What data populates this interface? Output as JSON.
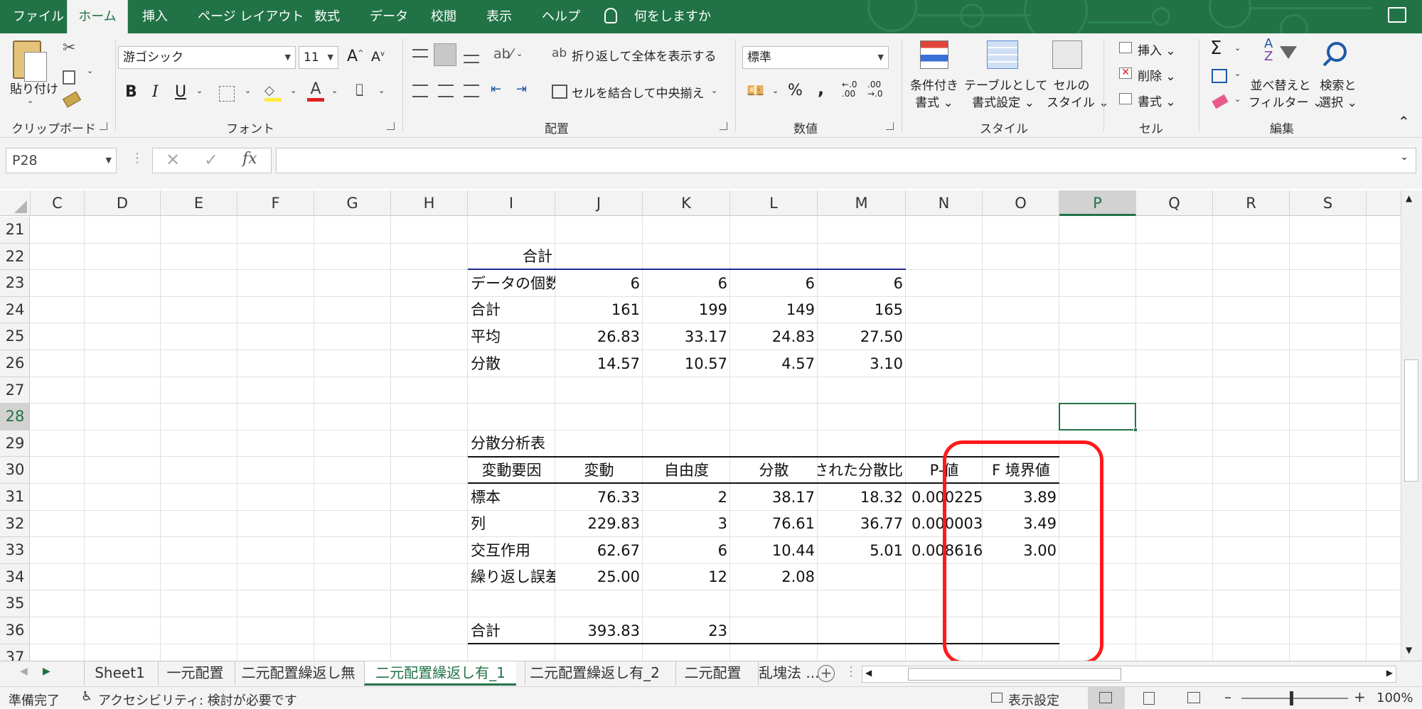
{
  "ribbon_tabs": [
    "ファイル",
    "ホーム",
    "挿入",
    "ページ レイアウト",
    "数式",
    "データ",
    "校閲",
    "表示",
    "ヘルプ"
  ],
  "tell_me": "何をしますか",
  "ribbon": {
    "clipboard": {
      "paste": "貼り付け",
      "label": "クリップボード"
    },
    "font": {
      "name": "游ゴシック",
      "size": "11",
      "label": "フォント",
      "bold": "B",
      "italic": "I",
      "underline": "U"
    },
    "alignment": {
      "wrap": "折り返して全体を表示する",
      "merge": "セルを結合して中央揃え",
      "label": "配置"
    },
    "number": {
      "format": "標準",
      "percent": "%",
      "comma": ",",
      "label": "数値"
    },
    "styles": {
      "conditional": "条件付き\n書式",
      "table": "テーブルとして\n書式設定",
      "cell": "セルの\nスタイル",
      "label": "スタイル",
      "conditional_l1": "条件付き",
      "conditional_l2": "書式",
      "table_l1": "テーブルとして",
      "table_l2": "書式設定",
      "cell_l1": "セルの",
      "cell_l2": "スタイル"
    },
    "cells": {
      "insert": "挿入",
      "delete": "削除",
      "format": "書式",
      "label": "セル"
    },
    "editing": {
      "sum": "Σ",
      "sort_l1": "並べ替えと",
      "sort_l2": "フィルター",
      "find_l1": "検索と",
      "find_l2": "選択",
      "label": "編集"
    }
  },
  "name_box": "P28",
  "fx": "fx",
  "columns": [
    "C",
    "D",
    "E",
    "F",
    "G",
    "H",
    "I",
    "J",
    "K",
    "L",
    "M",
    "N",
    "O",
    "P",
    "Q",
    "R",
    "S"
  ],
  "rows": [
    "21",
    "22",
    "23",
    "24",
    "25",
    "26",
    "27",
    "28",
    "29",
    "30",
    "31",
    "32",
    "33",
    "34",
    "35",
    "36",
    "37"
  ],
  "selected_cell": {
    "column": "P",
    "row": "28"
  },
  "table1": {
    "heading": "合計",
    "rows": [
      {
        "label": "データの個数",
        "values": [
          "6",
          "6",
          "6",
          "6"
        ]
      },
      {
        "label": "合計",
        "values": [
          "161",
          "199",
          "149",
          "165"
        ]
      },
      {
        "label": "平均",
        "values": [
          "26.83",
          "33.17",
          "24.83",
          "27.50"
        ]
      },
      {
        "label": "分散",
        "values": [
          "14.57",
          "10.57",
          "4.57",
          "3.10"
        ]
      }
    ]
  },
  "anova": {
    "title": "分散分析表",
    "headers": [
      "変動要因",
      "変動",
      "自由度",
      "分散",
      "観測された分散比",
      "P-値",
      "F 境界値"
    ],
    "rows": [
      [
        "標本",
        "76.33",
        "2",
        "38.17",
        "18.32",
        "0.000225",
        "3.89"
      ],
      [
        "列",
        "229.83",
        "3",
        "76.61",
        "36.77",
        "0.000003",
        "3.49"
      ],
      [
        "交互作用",
        "62.67",
        "6",
        "10.44",
        "5.01",
        "0.008616",
        "3.00"
      ],
      [
        "繰り返し誤差",
        "25.00",
        "12",
        "2.08",
        "",
        "",
        ""
      ],
      [
        "",
        "",
        "",
        "",
        "",
        "",
        ""
      ],
      [
        "合計",
        "393.83",
        "23",
        "",
        "",
        "",
        ""
      ]
    ]
  },
  "sheet_tabs": [
    "Sheet1",
    "一元配置",
    "二元配置繰返し無",
    "二元配置繰返し有_1",
    "二元配置繰返し有_2",
    "二元配置",
    "乱塊法 ..."
  ],
  "active_sheet": "二元配置繰返し有_1",
  "status": {
    "ready": "準備完了",
    "accessibility": "アクセシビリティ: 検討が必要です",
    "display_settings": "表示設定",
    "zoom": "100%"
  },
  "highlight_color": "#ff1a1a",
  "accent_color": "#217346"
}
